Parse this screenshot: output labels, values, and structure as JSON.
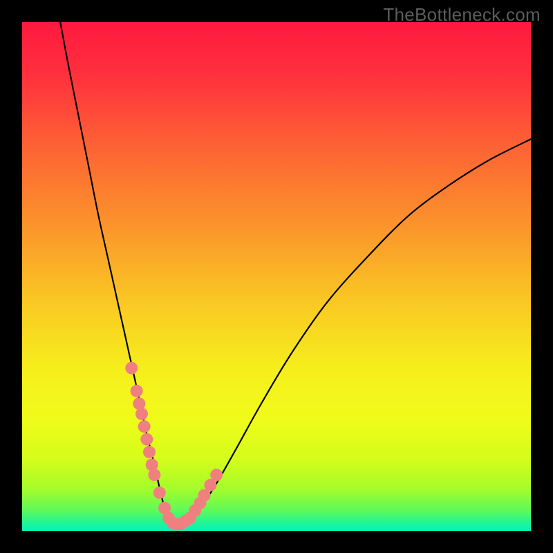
{
  "watermark": {
    "text": "TheBottleneck.com"
  },
  "gradient": {
    "stops": [
      {
        "offset": 0.0,
        "color": "#ff193f"
      },
      {
        "offset": 0.1,
        "color": "#ff2f3d"
      },
      {
        "offset": 0.25,
        "color": "#fd6434"
      },
      {
        "offset": 0.4,
        "color": "#fb942b"
      },
      {
        "offset": 0.55,
        "color": "#f9c823"
      },
      {
        "offset": 0.68,
        "color": "#f6ee1c"
      },
      {
        "offset": 0.78,
        "color": "#f0fb1a"
      },
      {
        "offset": 0.86,
        "color": "#d4fd1b"
      },
      {
        "offset": 0.92,
        "color": "#a2fc2c"
      },
      {
        "offset": 0.96,
        "color": "#5ef95a"
      },
      {
        "offset": 0.985,
        "color": "#1ef599"
      },
      {
        "offset": 1.0,
        "color": "#07f3bb"
      }
    ]
  },
  "chart_data": {
    "type": "line",
    "title": "",
    "xlabel": "",
    "ylabel": "",
    "xlim": [
      0,
      100
    ],
    "ylim": [
      0,
      100
    ],
    "grid": false,
    "series": [
      {
        "name": "bottleneck-curve",
        "x": [
          7.5,
          9,
          11,
          13,
          15,
          17,
          19,
          21,
          23,
          24.5,
          26,
          27,
          28,
          29,
          30,
          31.5,
          33,
          35,
          38,
          42,
          47,
          53,
          60,
          68,
          76,
          84,
          92,
          100
        ],
        "values": [
          100,
          92,
          82,
          72,
          62,
          53,
          44,
          35,
          26,
          19,
          13,
          8.5,
          4.5,
          2,
          1.3,
          1.3,
          2,
          4.5,
          9,
          16,
          25,
          35,
          45,
          54,
          62,
          68,
          73,
          77
        ]
      }
    ],
    "markers": {
      "name": "highlight-points",
      "color": "#f08080",
      "radius_px": 9,
      "x": [
        21.5,
        22.5,
        23,
        23.5,
        24,
        24.5,
        25,
        25.5,
        26,
        27,
        28,
        28.8,
        29.6,
        30.4,
        31.2,
        32.2,
        33,
        34,
        35,
        35.8,
        37,
        38.2
      ],
      "values": [
        32,
        27.5,
        25,
        23,
        20.5,
        18,
        15.5,
        13,
        11,
        7.5,
        4.5,
        2.5,
        1.6,
        1.3,
        1.4,
        2.0,
        2.5,
        4,
        5.5,
        7,
        9,
        11
      ]
    }
  }
}
